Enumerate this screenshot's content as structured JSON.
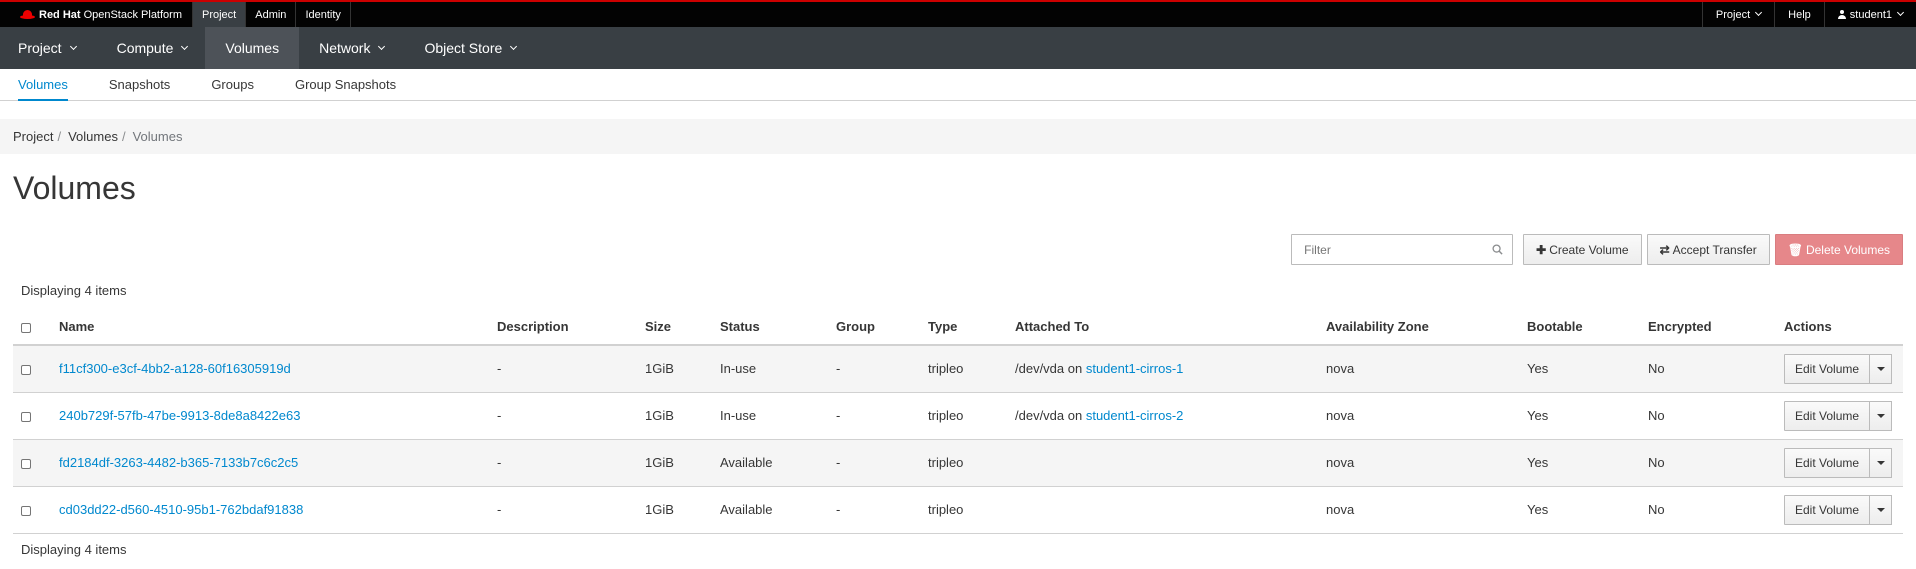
{
  "topbar": {
    "brand_bold": "Red Hat",
    "brand_rest": "OpenStack Platform",
    "tabs": [
      {
        "label": "Project"
      },
      {
        "label": "Admin"
      },
      {
        "label": "Identity"
      }
    ],
    "right": {
      "project_label": "Project",
      "help_label": "Help",
      "user_label": "student1"
    }
  },
  "primary_nav": [
    {
      "label": "Project"
    },
    {
      "label": "Compute"
    },
    {
      "label": "Volumes"
    },
    {
      "label": "Network"
    },
    {
      "label": "Object Store"
    }
  ],
  "secondary_nav": [
    {
      "label": "Volumes"
    },
    {
      "label": "Snapshots"
    },
    {
      "label": "Groups"
    },
    {
      "label": "Group Snapshots"
    }
  ],
  "breadcrumb": {
    "items": [
      "Project",
      "Volumes",
      "Volumes"
    ],
    "separator": "/"
  },
  "page_title": "Volumes",
  "toolbar": {
    "filter_placeholder": "Filter",
    "create_label": "Create Volume",
    "accept_label": "Accept Transfer",
    "delete_label": "Delete Volumes"
  },
  "count_text": "Displaying 4 items",
  "table": {
    "headers": {
      "name": "Name",
      "description": "Description",
      "size": "Size",
      "status": "Status",
      "group": "Group",
      "type": "Type",
      "attached": "Attached To",
      "zone": "Availability Zone",
      "bootable": "Bootable",
      "encrypted": "Encrypted",
      "actions": "Actions"
    },
    "rows": [
      {
        "name": "f11cf300-e3cf-4bb2-a128-60f16305919d",
        "description": "-",
        "size": "1GiB",
        "status": "In-use",
        "group": "-",
        "type": "tripleo",
        "attached_prefix": "/dev/vda on",
        "attached_link": "student1-cirros-1",
        "zone": "nova",
        "bootable": "Yes",
        "encrypted": "No",
        "action": "Edit Volume"
      },
      {
        "name": "240b729f-57fb-47be-9913-8de8a8422e63",
        "description": "-",
        "size": "1GiB",
        "status": "In-use",
        "group": "-",
        "type": "tripleo",
        "attached_prefix": "/dev/vda on",
        "attached_link": "student1-cirros-2",
        "zone": "nova",
        "bootable": "Yes",
        "encrypted": "No",
        "action": "Edit Volume"
      },
      {
        "name": "fd2184df-3263-4482-b365-7133b7c6c2c5",
        "description": "-",
        "size": "1GiB",
        "status": "Available",
        "group": "-",
        "type": "tripleo",
        "attached_prefix": "",
        "attached_link": "",
        "zone": "nova",
        "bootable": "Yes",
        "encrypted": "No",
        "action": "Edit Volume"
      },
      {
        "name": "cd03dd22-d560-4510-95b1-762bdaf91838",
        "description": "-",
        "size": "1GiB",
        "status": "Available",
        "group": "-",
        "type": "tripleo",
        "attached_prefix": "",
        "attached_link": "",
        "zone": "nova",
        "bootable": "Yes",
        "encrypted": "No",
        "action": "Edit Volume"
      }
    ]
  },
  "colors": {
    "link": "#0088ce",
    "topbar_bg": "#030303",
    "nav_bg": "#393f44",
    "danger": "#e6878a"
  }
}
